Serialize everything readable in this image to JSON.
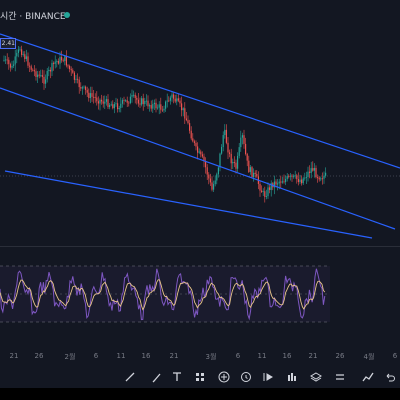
{
  "header": {
    "title": "시간 · BINANCE",
    "price_label": "2.41"
  },
  "time_axis": {
    "labels": [
      "21",
      "26",
      "2월",
      "6",
      "11",
      "16",
      "21",
      "3월",
      "6",
      "11",
      "16",
      "21",
      "26",
      "4월",
      "6"
    ]
  },
  "toolbar": {
    "tools": [
      "trend-line-icon",
      "brush-icon",
      "text-icon",
      "patterns-icon",
      "add-icon",
      "alert-icon",
      "replay-icon",
      "indicators-icon",
      "layers-icon",
      "compare-icon",
      "chart-type-icon",
      "undo-icon",
      "settings-icon"
    ]
  },
  "colors": {
    "background": "#131722",
    "trendline": "#2962ff",
    "candle_up": "#26a69a",
    "candle_down": "#ef5350",
    "rsi": "#7e57c2",
    "rsi_signal": "#e8c48a"
  }
}
